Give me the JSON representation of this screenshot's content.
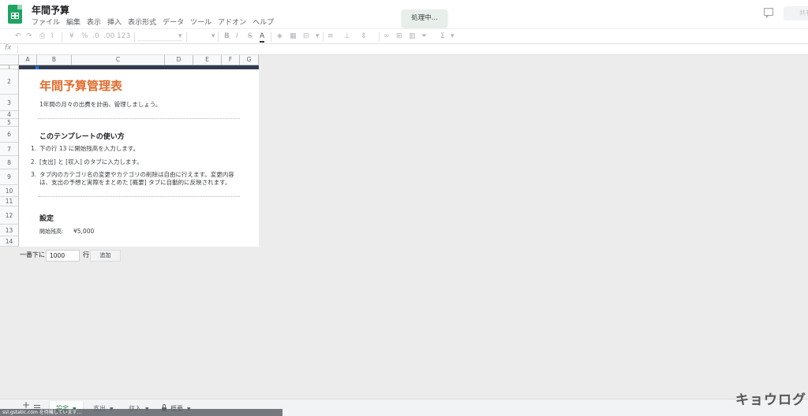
{
  "header": {
    "doc_title": "年間予算",
    "menu": [
      "ファイル",
      "編集",
      "表示",
      "挿入",
      "表示形式",
      "データ",
      "ツール",
      "アドオン",
      "ヘルプ"
    ],
    "toast": "処理中...",
    "share_label": "共有"
  },
  "toolbar": {
    "currency": "¥",
    "percent": "%",
    "dec_less": ".0",
    "dec_more": ".00",
    "number_format": "123"
  },
  "formula_bar": {
    "fx": "fx"
  },
  "grid": {
    "columns": [
      "A",
      "B",
      "C",
      "D",
      "E",
      "F",
      "G"
    ],
    "rows": [
      "1",
      "2",
      "3",
      "4",
      "5",
      "6",
      "7",
      "8",
      "9",
      "10",
      "11",
      "12",
      "13",
      "14"
    ]
  },
  "sheet": {
    "title": "年間予算管理表",
    "subtitle": "1年間の月々の出費を計画、管理しましょう。",
    "howto_heading": "このテンプレートの使い方",
    "steps": [
      {
        "num": "1.",
        "text": "下の行 13 に開始残高を入力します。"
      },
      {
        "num": "2.",
        "text": "[支出] と [収入] のタブに入力します。"
      },
      {
        "num": "3.",
        "text": "タブ内のカテゴリ名の変更やカテゴリの削除は自由に行えます。変更内容は、支出の予想と実際をまとめた [概要] タブに自動的に反映されます。"
      }
    ],
    "settings_heading": "設定",
    "opening_balance_label": "開始残高:",
    "opening_balance_value": "¥5,000"
  },
  "add_rows": {
    "prefix": "一番下に",
    "count": "1000",
    "suffix": "行",
    "button": "追加"
  },
  "tabs": [
    {
      "label": "設定",
      "active": true
    },
    {
      "label": "支出",
      "active": false
    },
    {
      "label": "収入",
      "active": false
    },
    {
      "label": "概要",
      "active": false,
      "locked": true
    }
  ],
  "status": "ssl.gstatic.com を待機しています...",
  "watermark": "キョウログ",
  "colors": {
    "accent_title": "#e06c2c",
    "band": "#323a4f",
    "active_tab": "#188038",
    "logo": "#1fa463"
  }
}
